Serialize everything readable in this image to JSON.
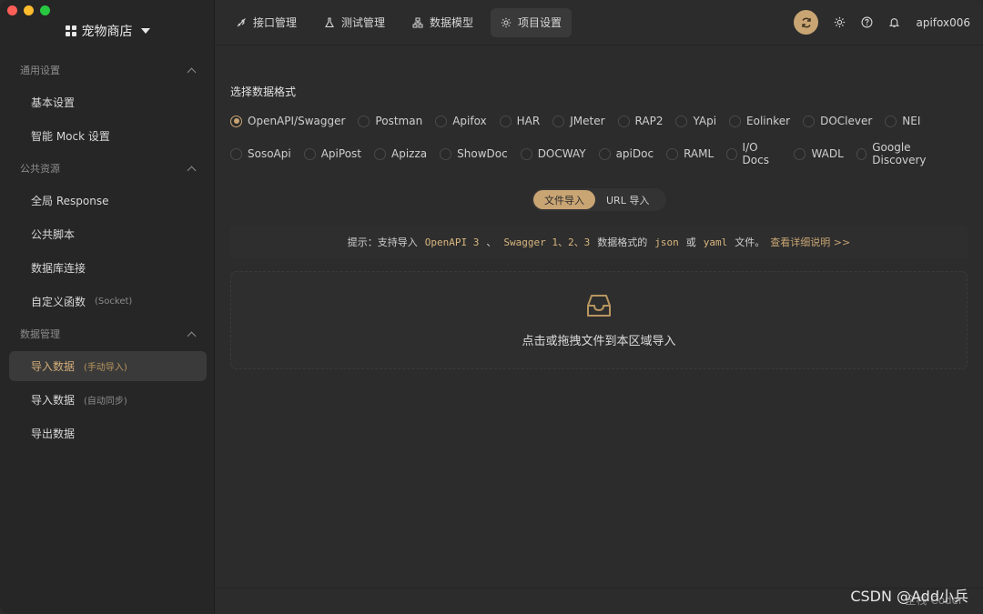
{
  "sidebar": {
    "project_name": "宠物商店",
    "groups": [
      {
        "title": "通用设置",
        "items": [
          {
            "label": "基本设置",
            "sub": ""
          },
          {
            "label": "智能 Mock 设置",
            "sub": ""
          }
        ]
      },
      {
        "title": "公共资源",
        "items": [
          {
            "label": "全局 Response",
            "sub": ""
          },
          {
            "label": "公共脚本",
            "sub": ""
          },
          {
            "label": "数据库连接",
            "sub": ""
          },
          {
            "label": "自定义函数",
            "sub": "(Socket)"
          }
        ]
      },
      {
        "title": "数据管理",
        "items": [
          {
            "label": "导入数据",
            "sub": "(手动导入)",
            "active": true
          },
          {
            "label": "导入数据",
            "sub": "(自动同步)"
          },
          {
            "label": "导出数据",
            "sub": ""
          }
        ]
      }
    ]
  },
  "topbar": {
    "tabs": [
      {
        "label": "接口管理",
        "icon": "rocket-icon"
      },
      {
        "label": "测试管理",
        "icon": "flask-icon"
      },
      {
        "label": "数据模型",
        "icon": "hierarchy-icon"
      },
      {
        "label": "项目设置",
        "icon": "gear-icon",
        "active": true
      }
    ],
    "username": "apifox006"
  },
  "main": {
    "section_label": "选择数据格式",
    "format_rows": [
      [
        "OpenAPI/Swagger",
        "Postman",
        "Apifox",
        "HAR",
        "JMeter",
        "RAP2",
        "YApi",
        "Eolinker",
        "DOClever",
        "NEI"
      ],
      [
        "SosoApi",
        "ApiPost",
        "Apizza",
        "ShowDoc",
        "DOCWAY",
        "apiDoc",
        "RAML",
        "I/O Docs",
        "WADL",
        "Google Discovery"
      ]
    ],
    "selected_format": "OpenAPI/Swagger",
    "import_modes": [
      "文件导入",
      "URL 导入"
    ],
    "active_mode": "文件导入",
    "tip": {
      "prefix": "提示：支持导入",
      "code1": "OpenAPI 3",
      "sep1": "、",
      "code2": "Swagger 1、2、3",
      "mid": "数据格式的",
      "code3": "json",
      "or": "或",
      "code4": "yaml",
      "suffix": "文件。",
      "link": "查看详细说明 >>"
    },
    "dropzone_text": "点击或拖拽文件到本区域导入"
  },
  "watermark": {
    "csdn": "CSDN @Add小兵",
    "secondary": "全栈 Coder"
  },
  "colors": {
    "accent": "#c9a574",
    "sidebar_bg": "#262626",
    "main_bg": "#2c2c2c"
  }
}
